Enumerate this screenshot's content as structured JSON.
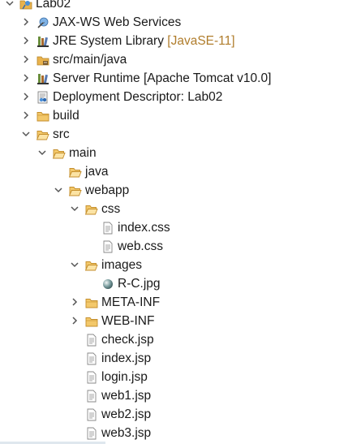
{
  "explorer": {
    "project": {
      "label": "Lab02",
      "icon": "project-icon",
      "expanded": true
    },
    "nodes": [
      {
        "label": "JAX-WS Web Services",
        "icon": "web-services-icon",
        "expanded": false
      },
      {
        "label": "JRE System Library",
        "decoration": "[JavaSE-11]",
        "icon": "library-icon",
        "expanded": false
      },
      {
        "label": "src/main/java",
        "icon": "source-folder-icon",
        "expanded": false
      },
      {
        "label": "Server Runtime [Apache Tomcat v10.0]",
        "icon": "library-icon",
        "expanded": false
      },
      {
        "label": "Deployment Descriptor: Lab02",
        "icon": "deployment-descriptor-icon",
        "expanded": false
      },
      {
        "label": "build",
        "icon": "folder-icon",
        "expanded": false
      },
      {
        "label": "src",
        "icon": "folder-icon",
        "expanded": true
      },
      {
        "label": "main",
        "icon": "folder-icon",
        "expanded": true
      },
      {
        "label": "java",
        "icon": "folder-icon"
      },
      {
        "label": "webapp",
        "icon": "folder-icon",
        "expanded": true
      },
      {
        "label": "css",
        "icon": "folder-icon",
        "expanded": true
      },
      {
        "label": "index.css",
        "icon": "css-file-icon"
      },
      {
        "label": "web.css",
        "icon": "css-file-icon"
      },
      {
        "label": "images",
        "icon": "folder-icon",
        "expanded": true
      },
      {
        "label": "R-C.jpg",
        "icon": "image-file-icon"
      },
      {
        "label": "META-INF",
        "icon": "folder-icon",
        "expanded": false
      },
      {
        "label": "WEB-INF",
        "icon": "folder-icon",
        "expanded": false
      },
      {
        "label": "check.jsp",
        "icon": "jsp-file-icon"
      },
      {
        "label": "index.jsp",
        "icon": "jsp-file-icon"
      },
      {
        "label": "login.jsp",
        "icon": "jsp-file-icon"
      },
      {
        "label": "web1.jsp",
        "icon": "jsp-file-icon"
      },
      {
        "label": "web2.jsp",
        "icon": "jsp-file-icon"
      },
      {
        "label": "web3.jsp",
        "icon": "jsp-file-icon"
      }
    ]
  },
  "colors": {
    "text": "#1a1a1a",
    "decoration": "#b07d2c",
    "folder": "#e9b24c",
    "twistie": "#555555"
  }
}
